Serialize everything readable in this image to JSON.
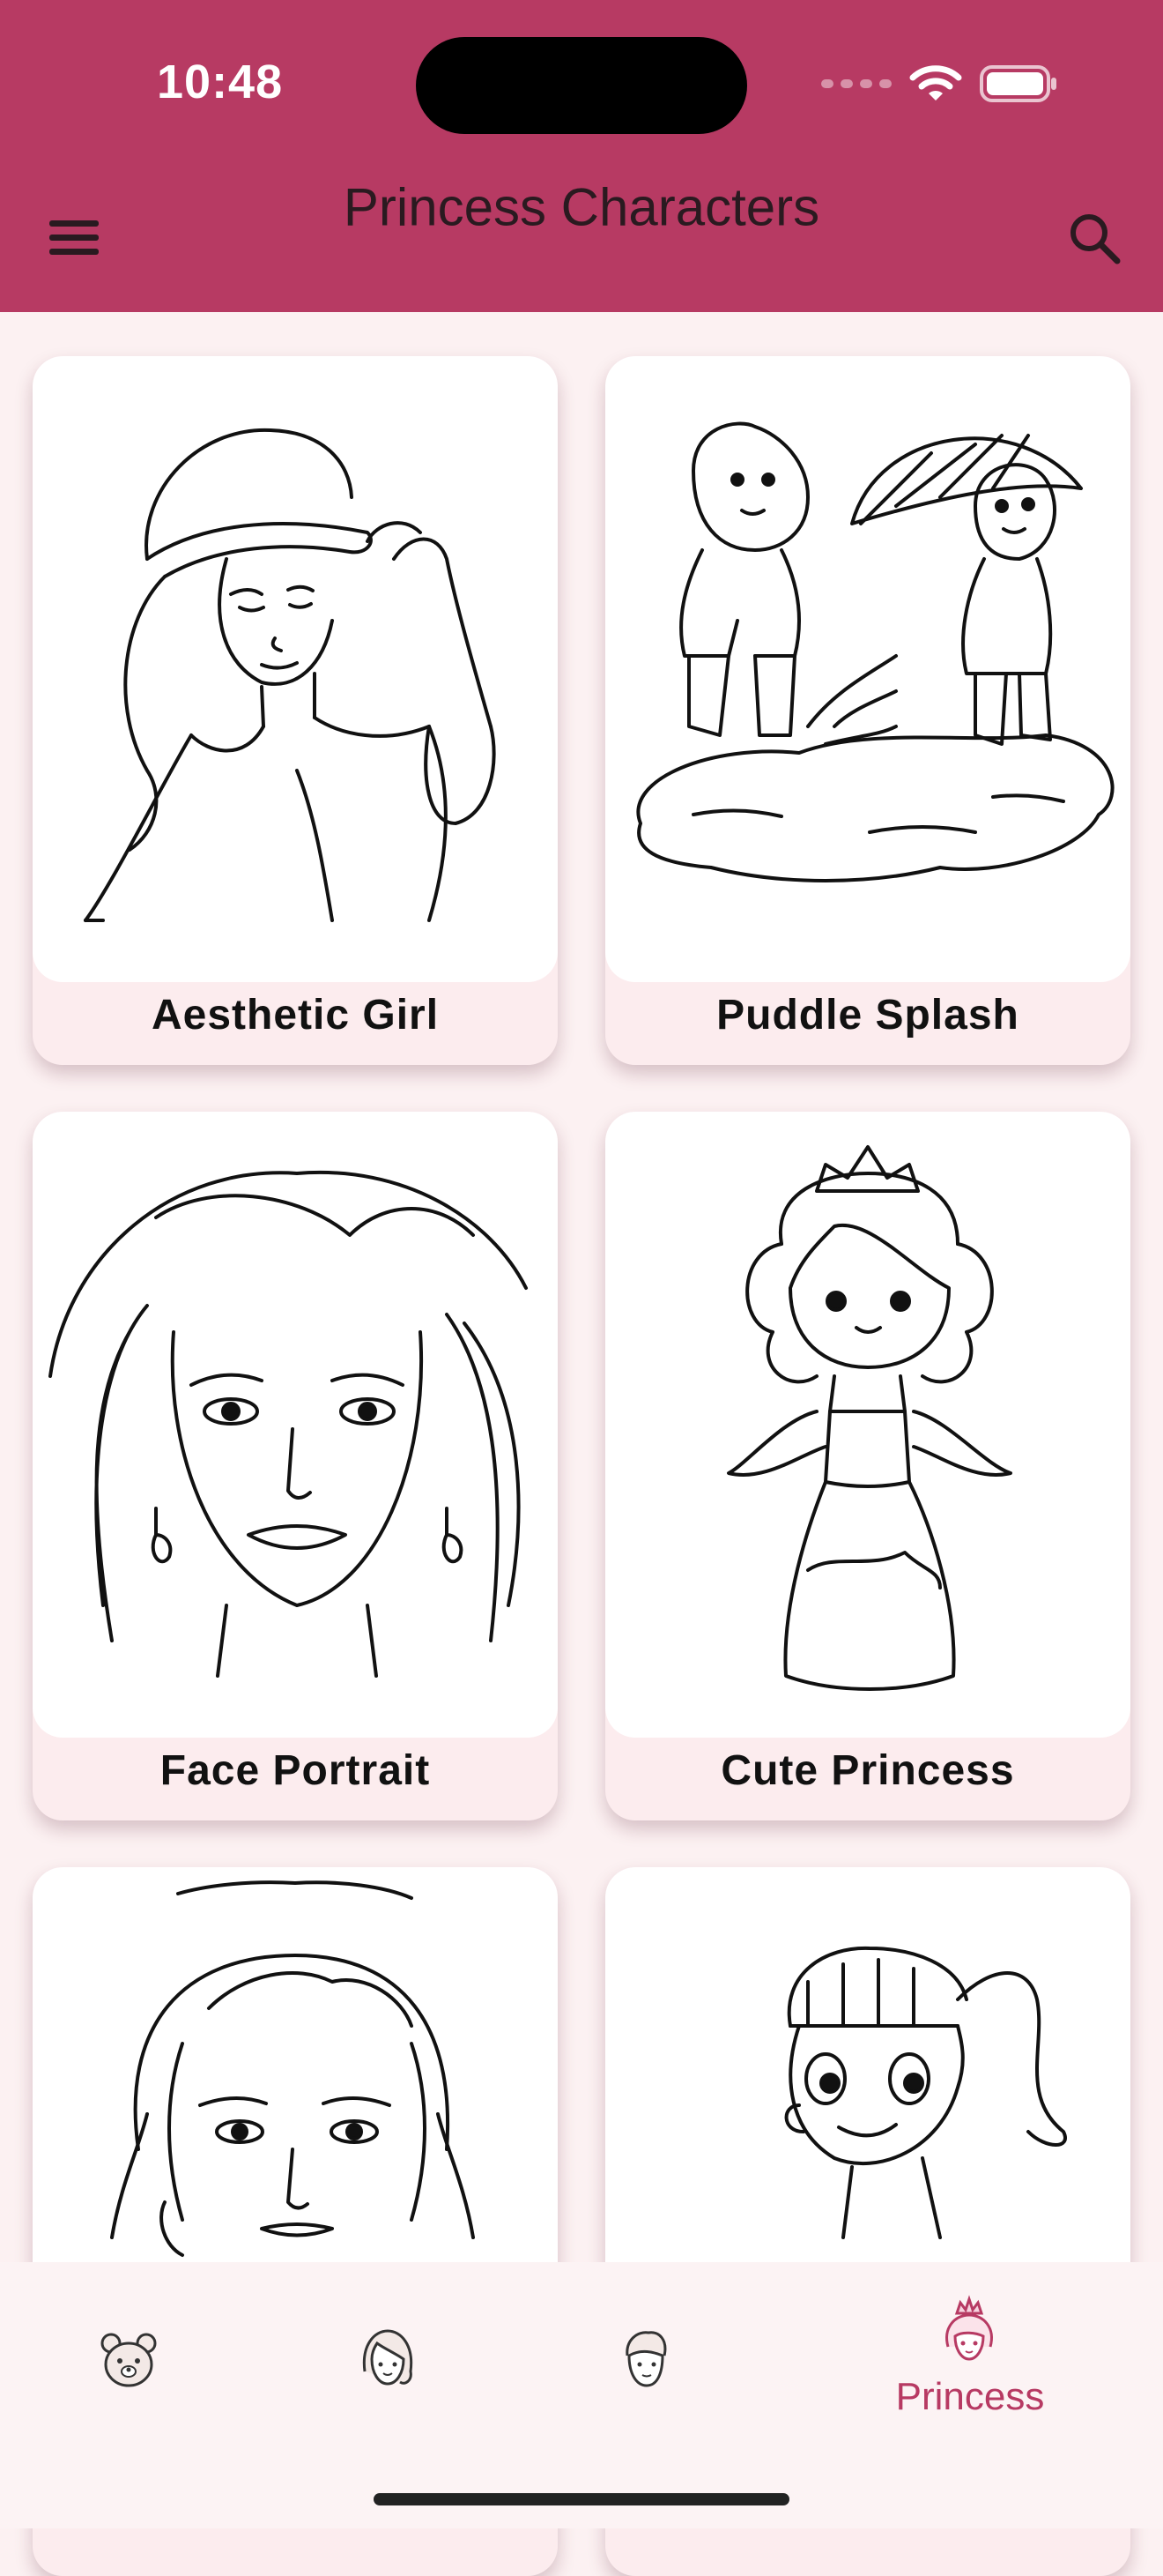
{
  "status_bar": {
    "time": "10:48"
  },
  "header": {
    "title": "Princess Characters"
  },
  "cards": [
    {
      "label": "Aesthetic Girl"
    },
    {
      "label": "Puddle Splash"
    },
    {
      "label": "Face Portrait"
    },
    {
      "label": "Cute Princess"
    },
    {
      "label": ""
    },
    {
      "label": ""
    }
  ],
  "bottom_nav": {
    "items": [
      {
        "icon": "bear-icon"
      },
      {
        "icon": "girl-icon"
      },
      {
        "icon": "boy-icon"
      },
      {
        "icon": "princess-icon",
        "label": "Princess",
        "active": true
      }
    ]
  },
  "colors": {
    "accent": "#b73a63",
    "background": "#fcf1f2",
    "card_footer": "#fcecee"
  }
}
